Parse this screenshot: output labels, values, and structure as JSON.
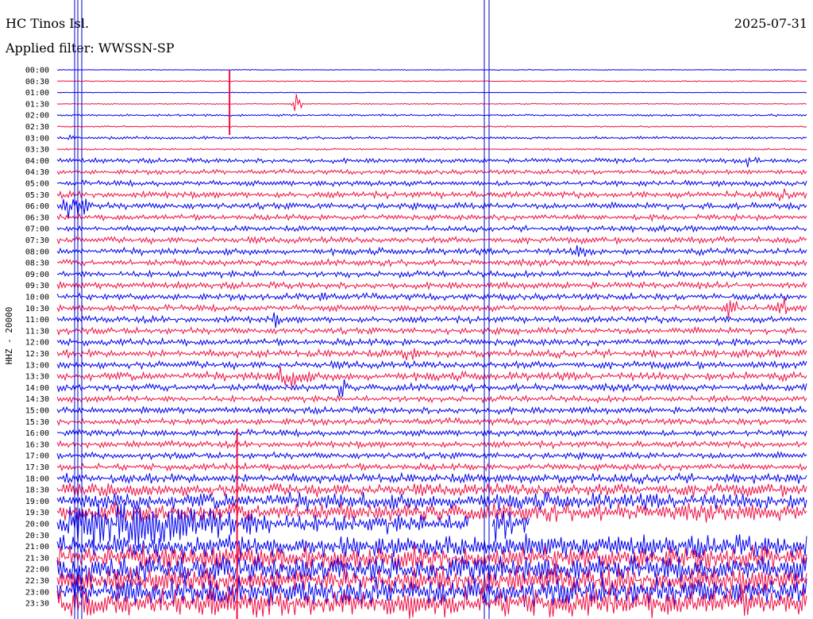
{
  "header": {
    "station": "HC Tinos Isl.",
    "filter": "Applied filter: WWSSN-SP",
    "date": "2025-07-31"
  },
  "chart_data": {
    "type": "line",
    "title": "HC Tinos Isl.",
    "subtitle": "Applied filter: WWSSN-SP",
    "date": "2025-07-31",
    "ylabel": "HHZ - 20000",
    "xlabel": "",
    "tick_labels": [
      "00:00",
      "00:30",
      "01:00",
      "01:30",
      "02:00",
      "02:30",
      "03:00",
      "03:30",
      "04:00",
      "04:30",
      "05:00",
      "05:30",
      "06:00",
      "06:30",
      "07:00",
      "07:30",
      "08:00",
      "08:30",
      "09:00",
      "09:30",
      "10:00",
      "10:30",
      "11:00",
      "11:30",
      "12:00",
      "12:30",
      "13:00",
      "13:30",
      "14:00",
      "14:30",
      "15:00",
      "15:30",
      "16:00",
      "16:30",
      "17:00",
      "17:30",
      "18:00",
      "18:30",
      "19:00",
      "19:30",
      "20:00",
      "20:30",
      "21:00",
      "21:30",
      "22:00",
      "22:30",
      "23:00",
      "23:30"
    ],
    "series_colors": [
      "#0000ee",
      "#ee1144"
    ],
    "noise_level": [
      0.5,
      0.6,
      0.4,
      0.6,
      1.2,
      0.8,
      1.5,
      1.0,
      2.5,
      2.5,
      3,
      3.5,
      3.5,
      3,
      3,
      3.5,
      3.5,
      3.5,
      3.5,
      3.5,
      3.5,
      3.5,
      3.5,
      3.5,
      3.5,
      4,
      4,
      4.5,
      4,
      3.5,
      3.5,
      3.5,
      3.5,
      3.5,
      3.5,
      3.5,
      5,
      7,
      9,
      10,
      10,
      9,
      12,
      13,
      14,
      14,
      15,
      15
    ],
    "events": [
      {
        "trace": 3,
        "pos": 0.32,
        "amp": 14,
        "width": 8
      },
      {
        "trace": 6,
        "pos": 0.02,
        "amp": 5,
        "width": 10
      },
      {
        "trace": 8,
        "pos": 0.92,
        "amp": 6,
        "width": 18
      },
      {
        "trace": 11,
        "pos": 0.97,
        "amp": 12,
        "width": 10
      },
      {
        "trace": 12,
        "pos": 0.02,
        "amp": 16,
        "width": 30
      },
      {
        "trace": 16,
        "pos": 0.7,
        "amp": 8,
        "width": 16
      },
      {
        "trace": 20,
        "pos": 0.35,
        "amp": 8,
        "width": 14
      },
      {
        "trace": 21,
        "pos": 0.9,
        "amp": 15,
        "width": 10
      },
      {
        "trace": 21,
        "pos": 0.97,
        "amp": 15,
        "width": 12
      },
      {
        "trace": 22,
        "pos": 0.29,
        "amp": 7,
        "width": 10
      },
      {
        "trace": 25,
        "pos": 0.47,
        "amp": 8,
        "width": 12
      },
      {
        "trace": 27,
        "pos": 0.31,
        "amp": 12,
        "width": 30
      },
      {
        "trace": 28,
        "pos": 0.38,
        "amp": 14,
        "width": 8
      },
      {
        "trace": 40,
        "pos": 0.08,
        "amp": 20,
        "width": 240
      },
      {
        "trace": 40,
        "pos": 0.58,
        "amp": 16,
        "width": 50
      }
    ],
    "gaps": [
      {
        "trace": 40,
        "from": 0.55,
        "to": 0.58
      },
      {
        "trace": 40,
        "from": 0.63,
        "to": 1.0
      },
      {
        "trace": 41,
        "from": 0.0,
        "to": 1.0
      }
    ],
    "spikes": [
      0.23,
      0.24
    ]
  }
}
